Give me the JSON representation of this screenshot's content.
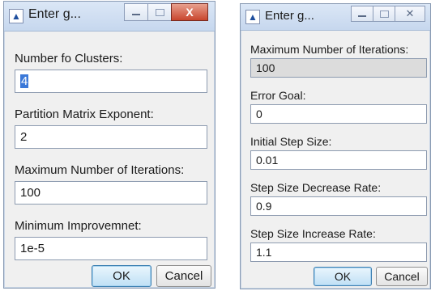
{
  "dialog_left": {
    "title": "Enter g...",
    "controls": {
      "close_glyph": "X"
    },
    "fields": [
      {
        "label": "Number fo Clusters:",
        "value": "4"
      },
      {
        "label": "Partition Matrix Exponent:",
        "value": "2"
      },
      {
        "label": "Maximum Number of Iterations:",
        "value": "100"
      },
      {
        "label": "Minimum Improvemnet:",
        "value": "1e-5"
      }
    ],
    "ok_label": "OK",
    "cancel_label": "Cancel"
  },
  "dialog_right": {
    "title": "Enter g...",
    "controls": {
      "close_glyph": "✕"
    },
    "fields": [
      {
        "label": "Maximum Number of Iterations:",
        "value": "100"
      },
      {
        "label": "Error Goal:",
        "value": "0"
      },
      {
        "label": "Initial Step Size:",
        "value": "0.01"
      },
      {
        "label": "Step Size Decrease Rate:",
        "value": "0.9"
      },
      {
        "label": "Step Size Increase Rate:",
        "value": "1.1"
      }
    ],
    "ok_label": "OK",
    "cancel_label": "Cancel"
  }
}
